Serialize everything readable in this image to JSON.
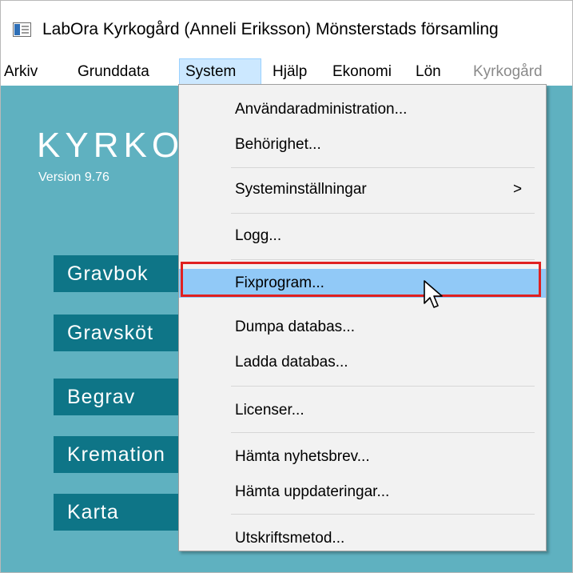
{
  "window": {
    "title": "LabOra Kyrkogård (Anneli Eriksson) Mönsterstads församling",
    "icon": "app-window-icon"
  },
  "menubar": {
    "items": [
      {
        "label": "Arkiv",
        "state": "normal"
      },
      {
        "label": "Grunddata",
        "state": "normal"
      },
      {
        "label": "System",
        "state": "active"
      },
      {
        "label": "Hjälp",
        "state": "normal"
      },
      {
        "label": "Ekonomi",
        "state": "normal"
      },
      {
        "label": "Lön",
        "state": "normal"
      },
      {
        "label": "Kyrkogård",
        "state": "disabled"
      }
    ]
  },
  "app": {
    "logo_text": "KYRKO",
    "version": "Version 9.76",
    "background_color": "#5fb1c0",
    "button_color": "#0e7587",
    "nav_buttons": [
      {
        "label": "Gravbok"
      },
      {
        "label": "Gravsköt"
      },
      {
        "label": "Begrav"
      },
      {
        "label": "Kremation"
      },
      {
        "label": "Karta"
      }
    ]
  },
  "dropdown": {
    "items": [
      {
        "label": "Användaradministration..."
      },
      {
        "label": "Behörighet..."
      },
      {
        "label": "Systeminställningar",
        "submenu_indicator": ">"
      },
      {
        "label": "Logg..."
      },
      {
        "label": "Fixprogram...",
        "highlighted": true
      },
      {
        "label": "Dumpa databas..."
      },
      {
        "label": "Ladda databas..."
      },
      {
        "label": "Licenser..."
      },
      {
        "label": "Hämta nyhetsbrev..."
      },
      {
        "label": "Hämta uppdateringar..."
      },
      {
        "label": "Utskriftsmetod..."
      }
    ],
    "highlight_color": "#91c9f7"
  },
  "annotation": {
    "color": "#e02020",
    "target": "Fixprogram..."
  }
}
